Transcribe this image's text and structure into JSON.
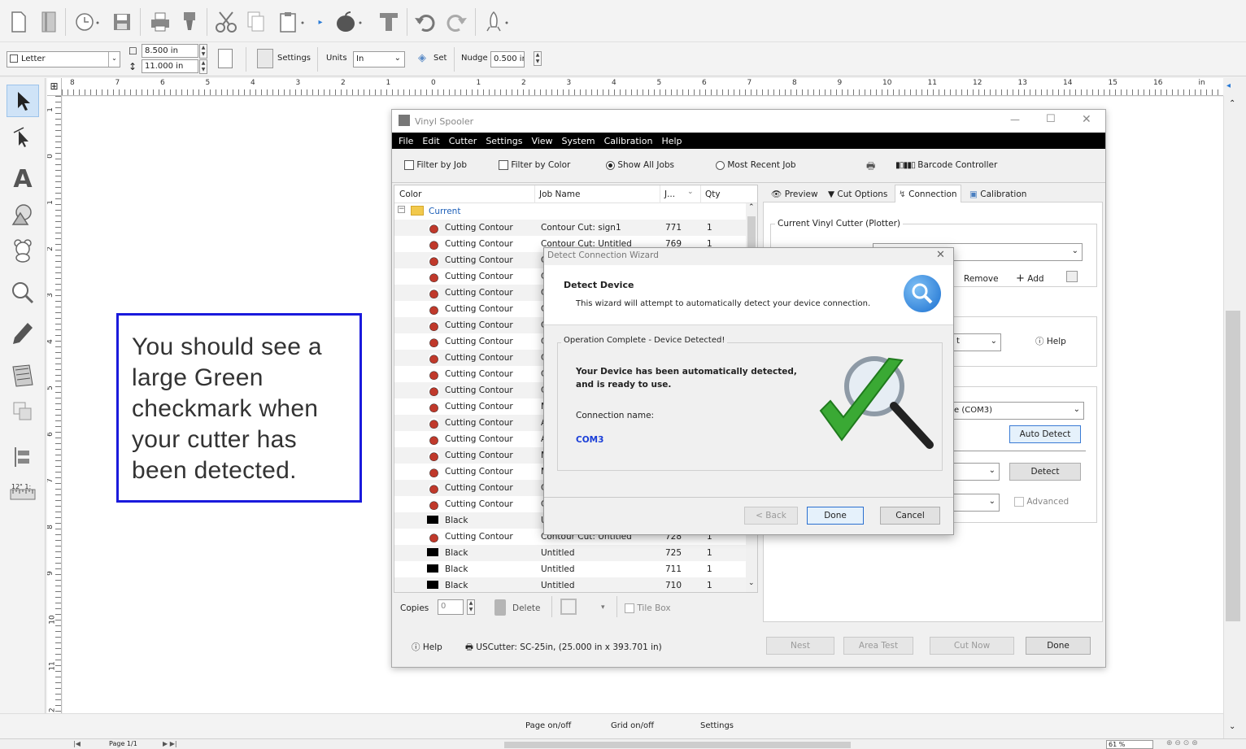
{
  "toolbar2": {
    "paper": "Letter",
    "width": "8.500 in",
    "height": "11.000 in",
    "settings": "Settings",
    "units_label": "Units",
    "units_value": "In",
    "set": "Set",
    "nudge_label": "Nudge",
    "nudge_value": "0.500 in"
  },
  "ruler_h": [
    "8",
    "7",
    "6",
    "5",
    "4",
    "3",
    "2",
    "1",
    "0",
    "1",
    "2",
    "3",
    "4",
    "5",
    "6",
    "7",
    "8",
    "9",
    "10",
    "11",
    "12",
    "13",
    "14",
    "15",
    "16",
    "in"
  ],
  "ruler_v": [
    "1",
    "0",
    "1",
    "2",
    "3",
    "4",
    "5",
    "6",
    "7",
    "8",
    "9",
    "10",
    "11",
    "12"
  ],
  "note": {
    "text": "You should see a large Green checkmark when your cutter has been detected."
  },
  "spooler": {
    "title": "Vinyl Spooler",
    "menu": [
      "File",
      "Edit",
      "Cutter",
      "Settings",
      "View",
      "System",
      "Calibration",
      "Help"
    ],
    "filters": {
      "by_job": "Filter by Job",
      "by_color": "Filter by Color",
      "show_all": "Show All Jobs",
      "most_recent": "Most Recent Job",
      "barcode": "Barcode Controller"
    },
    "columns": {
      "color": "Color",
      "job": "Job Name",
      "j": "J...",
      "qty": "Qty"
    },
    "group": "Current",
    "rows": [
      {
        "color": "Cutting Contour",
        "job": "Contour Cut: sign1",
        "j": "771",
        "qty": "1"
      },
      {
        "color": "Cutting Contour",
        "job": "Contour Cut: Untitled",
        "j": "769",
        "qty": "1"
      },
      {
        "color": "Cutting Contour",
        "job": "C",
        "j": "",
        "qty": ""
      },
      {
        "color": "Cutting Contour",
        "job": "C",
        "j": "",
        "qty": ""
      },
      {
        "color": "Cutting Contour",
        "job": "C",
        "j": "",
        "qty": ""
      },
      {
        "color": "Cutting Contour",
        "job": "C",
        "j": "",
        "qty": ""
      },
      {
        "color": "Cutting Contour",
        "job": "C",
        "j": "",
        "qty": ""
      },
      {
        "color": "Cutting Contour",
        "job": "C",
        "j": "",
        "qty": ""
      },
      {
        "color": "Cutting Contour",
        "job": "C",
        "j": "",
        "qty": ""
      },
      {
        "color": "Cutting Contour",
        "job": "C",
        "j": "",
        "qty": ""
      },
      {
        "color": "Cutting Contour",
        "job": "C",
        "j": "",
        "qty": ""
      },
      {
        "color": "Cutting Contour",
        "job": "M",
        "j": "",
        "qty": ""
      },
      {
        "color": "Cutting Contour",
        "job": "A",
        "j": "",
        "qty": ""
      },
      {
        "color": "Cutting Contour",
        "job": "A",
        "j": "",
        "qty": ""
      },
      {
        "color": "Cutting Contour",
        "job": "M",
        "j": "",
        "qty": ""
      },
      {
        "color": "Cutting Contour",
        "job": "M",
        "j": "",
        "qty": ""
      },
      {
        "color": "Cutting Contour",
        "job": "C",
        "j": "",
        "qty": ""
      },
      {
        "color": "Cutting Contour",
        "job": "C",
        "j": "",
        "qty": ""
      },
      {
        "color": "Black",
        "job": "U",
        "j": "",
        "qty": ""
      },
      {
        "color": "Cutting Contour",
        "job": "Contour Cut: Untitled",
        "j": "728",
        "qty": "1"
      },
      {
        "color": "Black",
        "job": "Untitled",
        "j": "725",
        "qty": "1"
      },
      {
        "color": "Black",
        "job": "Untitled",
        "j": "711",
        "qty": "1"
      },
      {
        "color": "Black",
        "job": "Untitled",
        "j": "710",
        "qty": "1"
      }
    ],
    "tabs": [
      "Preview",
      "Cut Options",
      "Connection",
      "Calibration"
    ],
    "current_cutter": "Current Vinyl Cutter (Plotter)",
    "remove": "Remove",
    "add": "Add",
    "help": "Help",
    "port": "e (COM3)",
    "auto_detect": "Auto Detect",
    "detect": "Detect",
    "advanced": "Advanced",
    "copies_label": "Copies",
    "copies_value": "0",
    "delete": "Delete",
    "tile_box": "Tile Box",
    "help_bottom": "Help",
    "cutter_info": "USCutter: SC-25in,  (25.000 in x 393.701 in)",
    "nest": "Nest",
    "area_test": "Area Test",
    "cut_now": "Cut Now",
    "done": "Done"
  },
  "wizard": {
    "title": "Detect Connection Wizard",
    "heading": "Detect Device",
    "subtext": "This wizard will attempt to automatically detect your device connection.",
    "group": "Operation Complete - Device Detected!",
    "msg1": "Your Device has been automatically detected,",
    "msg2": "and is ready to use.",
    "conn_label": "Connection name:",
    "conn_value": "COM3",
    "back": "< Back",
    "done": "Done",
    "cancel": "Cancel"
  },
  "status": {
    "page": "Page on/off",
    "grid": "Grid on/off",
    "settings": "Settings"
  },
  "bottom": {
    "page": "Page 1/1",
    "zoom": "61 %"
  }
}
